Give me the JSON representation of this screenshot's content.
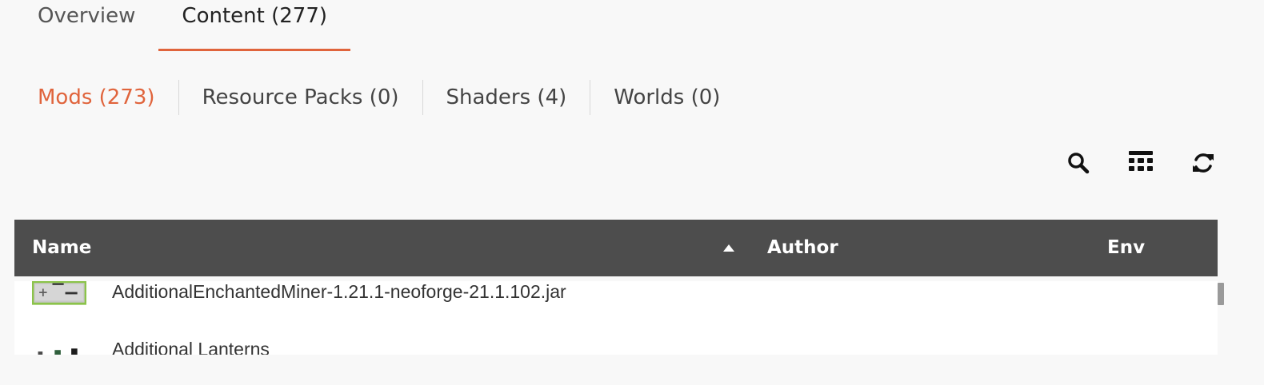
{
  "main_tabs": [
    {
      "label": "Overview",
      "active": false
    },
    {
      "label": "Content (277)",
      "active": true
    }
  ],
  "sub_tabs": [
    {
      "label": "Mods (273)",
      "active": true
    },
    {
      "label": "Resource Packs (0)",
      "active": false
    },
    {
      "label": "Shaders (4)",
      "active": false
    },
    {
      "label": "Worlds (0)",
      "active": false
    }
  ],
  "toolbar": {
    "icons": [
      "search-icon",
      "columns-icon",
      "refresh-icon"
    ]
  },
  "table": {
    "columns": {
      "name": "Name",
      "author": "Author",
      "env": "Env"
    },
    "sort": {
      "column": "Name",
      "direction": "ascending"
    },
    "rows": [
      {
        "name": "AdditionalEnchantedMiner-1.21.1-neoforge-21.1.102.jar",
        "icon": "mod-icon-quarry"
      },
      {
        "name": "Additional Lanterns",
        "icon": "mod-icon-lantern"
      }
    ]
  },
  "colors": {
    "accent": "#e0643c",
    "header_bg": "#4d4d4d",
    "page_bg": "#f8f8f8"
  }
}
